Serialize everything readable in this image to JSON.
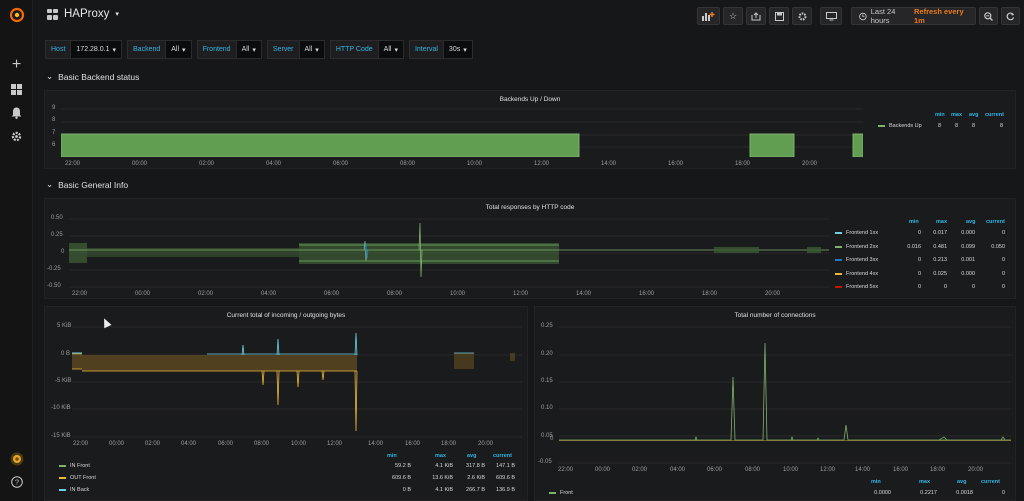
{
  "dashboard": {
    "title": "HAProxy"
  },
  "toolbar": {
    "time_range": "Last 24 hours",
    "refresh": "Refresh every 1m"
  },
  "variables": [
    {
      "label": "Host",
      "value": "172.28.0.1"
    },
    {
      "label": "Backend",
      "value": "All"
    },
    {
      "label": "Frontend",
      "value": "All"
    },
    {
      "label": "Server",
      "value": "All"
    },
    {
      "label": "HTTP Code",
      "value": "All"
    },
    {
      "label": "Interval",
      "value": "30s"
    }
  ],
  "rows": {
    "backend": "Basic Backend status",
    "general": "Basic General Info"
  },
  "legend_headers": {
    "min": "min",
    "max": "max",
    "avg": "avg",
    "current": "current"
  },
  "time_ticks": [
    "22:00",
    "00:00",
    "02:00",
    "04:00",
    "06:00",
    "08:00",
    "10:00",
    "12:00",
    "14:00",
    "16:00",
    "18:00",
    "20:00"
  ],
  "panels": {
    "backends": {
      "title": "Backends Up / Down",
      "y_ticks": [
        "9",
        "8",
        "7",
        "6"
      ],
      "legend": [
        {
          "name": "Backends Up",
          "color": "#7eb26d",
          "min": "8",
          "max": "8",
          "avg": "8",
          "current": "8"
        }
      ]
    },
    "responses": {
      "title": "Total responses by HTTP code",
      "y_ticks": [
        "0.50",
        "0.25",
        "0",
        "-0.25",
        "-0.50"
      ],
      "legend": [
        {
          "name": "Frontend 1xx",
          "color": "#6ed0e0",
          "min": "0",
          "max": "0.017",
          "avg": "0.000",
          "current": "0"
        },
        {
          "name": "Frontend 2xx",
          "color": "#7eb26d",
          "min": "0.016",
          "max": "0.481",
          "avg": "0.099",
          "current": "0.050"
        },
        {
          "name": "Frontend 3xx",
          "color": "#1f78c1",
          "min": "0",
          "max": "0.213",
          "avg": "0.001",
          "current": "0"
        },
        {
          "name": "Frontend 4xx",
          "color": "#eab839",
          "min": "0",
          "max": "0.025",
          "avg": "0.000",
          "current": "0"
        },
        {
          "name": "Frontend 5xx",
          "color": "#bf1b00",
          "min": "0",
          "max": "0",
          "avg": "0",
          "current": "0"
        }
      ]
    },
    "bytes": {
      "title": "Current total of incoming / outgoing bytes",
      "y_ticks": [
        "5 KiB",
        "0 B",
        "-5 KiB",
        "-10 KiB",
        "-15 KiB"
      ],
      "legend": [
        {
          "name": "IN Front",
          "color": "#7eb26d",
          "min": "59.2 B",
          "max": "4.1 KiB",
          "avg": "317.8 B",
          "current": "147.1 B"
        },
        {
          "name": "OUT Front",
          "color": "#eab839",
          "min": "609.6 B",
          "max": "13.6 KiB",
          "avg": "2.6 KiB",
          "current": "609.6 B"
        },
        {
          "name": "IN Back",
          "color": "#6ed0e0",
          "min": "0 B",
          "max": "4.1 KiB",
          "avg": "266.7 B",
          "current": "136.9 B"
        }
      ]
    },
    "connections": {
      "title": "Total number of connections",
      "y_ticks": [
        "0.25",
        "0.20",
        "0.15",
        "0.10",
        "0.05",
        "0",
        "-0.05"
      ],
      "legend": [
        {
          "name": "Front",
          "color": "#7eb26d",
          "min": "0.0000",
          "max": "0.2217",
          "avg": "0.0018",
          "current": "0"
        }
      ]
    }
  }
}
